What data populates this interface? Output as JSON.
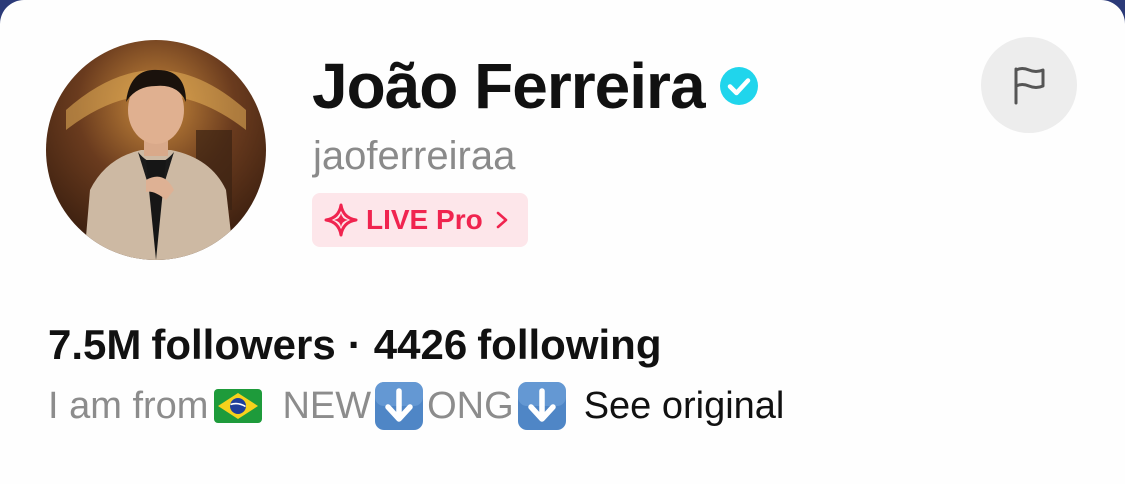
{
  "profile": {
    "display_name": "João Ferreira",
    "username": "jaoferreiraa",
    "avatar_icon": "profile-photo",
    "verified_icon": "verified-badge-icon",
    "live_pro_label": "LIVE Pro",
    "followers_count": "7.5M",
    "followers_label": "followers",
    "separator": "·",
    "following_count": "4426",
    "following_label": "following"
  },
  "bio": {
    "text_before": "I am from",
    "flag_emoji": "brazil-flag-emoji",
    "word_1": "NEW",
    "word_2": "ONG",
    "arrow_emoji": "down-arrow-emoji",
    "see_original_label": "See original"
  },
  "actions": {
    "report_icon": "flag-icon"
  },
  "colors": {
    "accent_pink": "#f0244f",
    "pill_bg": "#fde6ea",
    "verified_blue": "#20d5ec",
    "muted_text": "#8a8a8a"
  }
}
